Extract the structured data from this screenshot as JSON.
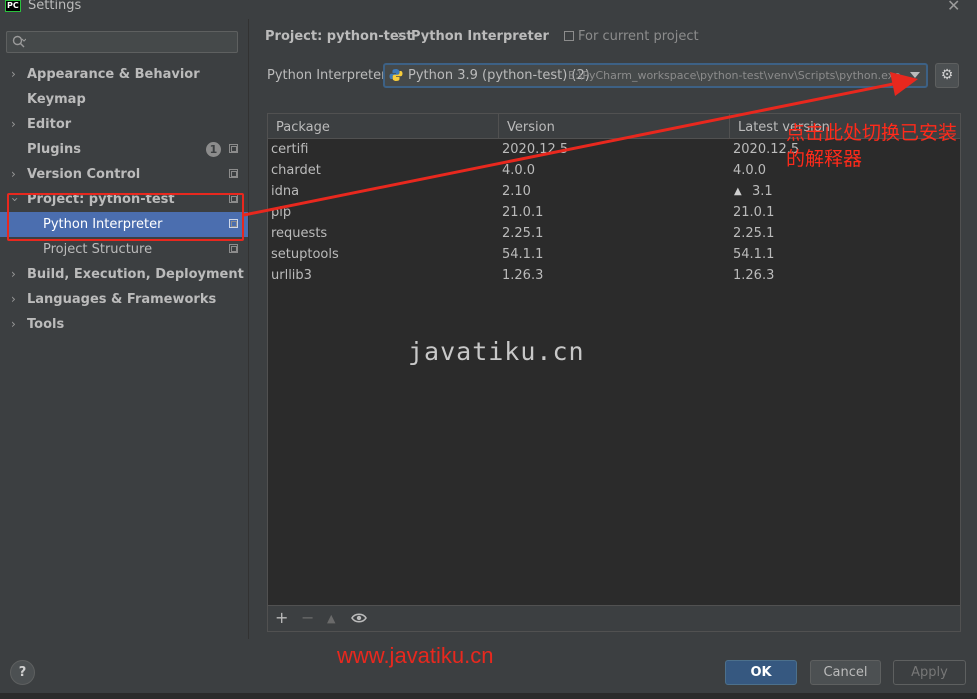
{
  "window": {
    "title": "Settings",
    "app_icon_text": "PC"
  },
  "sidebar": {
    "search_placeholder": "",
    "items": [
      {
        "label": "Appearance & Behavior",
        "expandable": true
      },
      {
        "label": "Keymap",
        "expandable": false
      },
      {
        "label": "Editor",
        "expandable": true
      },
      {
        "label": "Plugins",
        "expandable": false,
        "badge": "1"
      },
      {
        "label": "Version Control",
        "expandable": true
      },
      {
        "label": "Project: python-test",
        "expanded": true
      },
      {
        "label": "Python Interpreter",
        "selected": true
      },
      {
        "label": "Project Structure"
      },
      {
        "label": "Build, Execution, Deployment",
        "expandable": true
      },
      {
        "label": "Languages & Frameworks",
        "expandable": true
      },
      {
        "label": "Tools",
        "expandable": true
      }
    ]
  },
  "header": {
    "breadcrumb": [
      "Project: python-test",
      "Python Interpreter"
    ],
    "separator": "›",
    "scope_note": "For current project"
  },
  "interpreter": {
    "label": "Python Interpreter:",
    "name": "Python 3.9 (python-test) (2)",
    "path": "E:\\PyCharm_workspace\\python-test\\venv\\Scripts\\python.exe"
  },
  "table": {
    "columns": [
      "Package",
      "Version",
      "Latest version"
    ],
    "rows": [
      {
        "package": "certifi",
        "version": "2020.12.5",
        "latest": "2020.12.5",
        "upgrade": false
      },
      {
        "package": "chardet",
        "version": "4.0.0",
        "latest": "4.0.0",
        "upgrade": false
      },
      {
        "package": "idna",
        "version": "2.10",
        "latest": "3.1",
        "upgrade": true
      },
      {
        "package": "pip",
        "version": "21.0.1",
        "latest": "21.0.1",
        "upgrade": false
      },
      {
        "package": "requests",
        "version": "2.25.1",
        "latest": "2.25.1",
        "upgrade": false
      },
      {
        "package": "setuptools",
        "version": "54.1.1",
        "latest": "54.1.1",
        "upgrade": false
      },
      {
        "package": "urllib3",
        "version": "1.26.3",
        "latest": "1.26.3",
        "upgrade": false
      }
    ],
    "toolbar": {
      "add": "+",
      "remove": "−",
      "upgrade": "▲",
      "show": "eye-icon"
    }
  },
  "annotation": {
    "text": "点击此处切换已安装的解释器",
    "color": "#ff2a1a"
  },
  "watermarks": {
    "mono": "javatiku.cn",
    "url": "www.javatiku.cn"
  },
  "buttons": {
    "help": "?",
    "ok": "OK",
    "cancel": "Cancel",
    "apply": "Apply"
  },
  "colors": {
    "selection": "#4b6eaf",
    "ok_button": "#365880",
    "accent_border": "#3d6185",
    "annotation_red": "#e8281e"
  }
}
